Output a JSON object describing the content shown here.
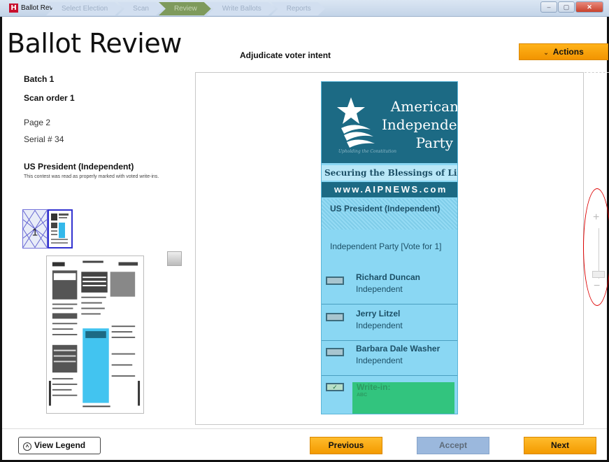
{
  "window": {
    "title": "Ballot Review",
    "breadcrumbs": [
      "Select Election",
      "Scan",
      "Review",
      "Write Ballots",
      "Reports"
    ],
    "active_crumb": "Review",
    "controls": [
      "minimize",
      "maximize",
      "close"
    ]
  },
  "header": {
    "title": "Ballot Review",
    "subtitle": "Adjudicate voter intent",
    "actions_label": "Actions"
  },
  "left_panel": {
    "batch": "Batch  1",
    "scan_order": "Scan order  1",
    "page": "Page  2",
    "serial": "Serial # 34",
    "contest": "US President (Independent)",
    "contest_note": "This contest was read as properly marked with voted write-ins."
  },
  "ballot": {
    "party_lines": [
      "American",
      "Independent",
      "Party"
    ],
    "tagline": "Upholding the Constitution",
    "slogan": "Securing the Blessings of Liberty",
    "website": "www.AIPNEWS.com",
    "contest": "US President (Independent)",
    "instructions": "Independent Party [Vote for 1]",
    "candidates": [
      {
        "name": "Richard Duncan",
        "party": "Independent"
      },
      {
        "name": "Jerry Litzel",
        "party": "Independent"
      },
      {
        "name": "Barbara Dale Washer",
        "party": "Independent"
      }
    ],
    "write_in_label": "Write-in:",
    "write_in_value": "ABC"
  },
  "zoom": {
    "plus": "+",
    "minus": "−"
  },
  "footer": {
    "legend_label": "View Legend",
    "previous_label": "Previous",
    "accept_label": "Accept",
    "next_label": "Next"
  },
  "colors": {
    "accent_orange": "#f5a000",
    "ballot_blue": "#8ad7f3",
    "header_teal": "#1c6a84",
    "writein_green": "#32c47e",
    "annotation_red": "#dd0000"
  }
}
